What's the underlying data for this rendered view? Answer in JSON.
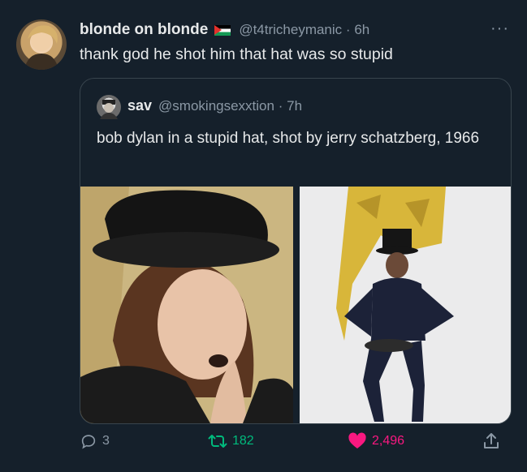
{
  "tweet": {
    "author_name": "blonde on blonde",
    "author_handle": "@t4tricheymanic",
    "separator": "·",
    "time": "6h",
    "text": "thank god he shot him that hat was so stupid",
    "more_label": "···",
    "flag_icon": "palestine-flag-icon"
  },
  "quoted": {
    "author_name": "sav",
    "author_handle": "@smokingsexxtion",
    "separator": "·",
    "time": "7h",
    "text": "bob dylan in a stupid hat, shot by jerry schatzberg, 1966",
    "photos": [
      {
        "subject": "man in top hat close-up, finger to mouth"
      },
      {
        "subject": "man in top hat seated on stool, white backdrop"
      }
    ]
  },
  "actions": {
    "reply_count": "3",
    "retweet_count": "182",
    "like_count": "2,496",
    "colors": {
      "retweet": "#00ba7c",
      "like": "#f91880",
      "muted": "#8b98a5"
    }
  }
}
